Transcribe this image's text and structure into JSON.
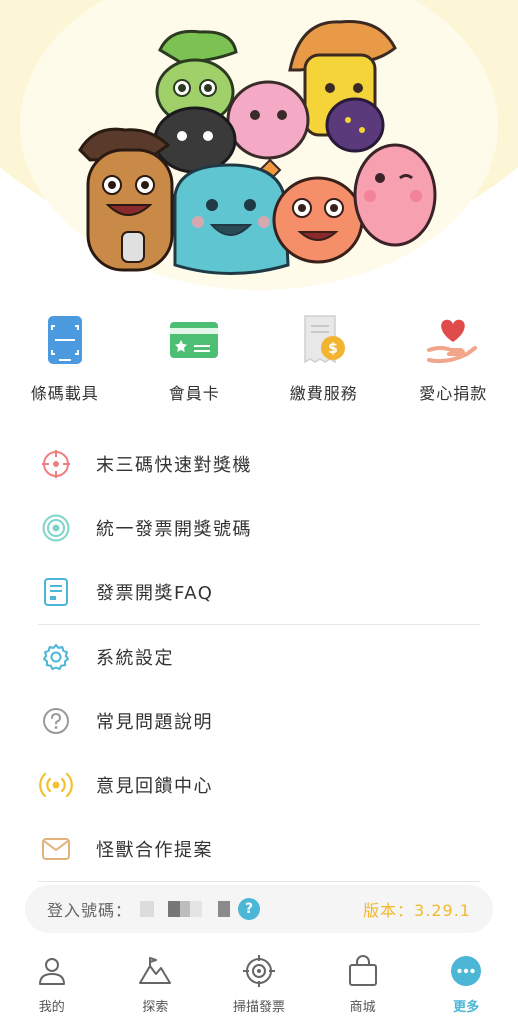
{
  "hero": {
    "icon": "monster-group-illustration"
  },
  "quick_actions": [
    {
      "label": "條碼載具",
      "icon": "barcode-carrier-icon"
    },
    {
      "label": "會員卡",
      "icon": "member-card-icon"
    },
    {
      "label": "繳費服務",
      "icon": "payment-service-icon"
    },
    {
      "label": "愛心捐款",
      "icon": "donation-heart-icon"
    }
  ],
  "menu": [
    {
      "label": "末三碼快速對獎機",
      "icon": "crosshair-icon"
    },
    {
      "label": "統一發票開獎號碼",
      "icon": "target-icon"
    },
    {
      "label": "發票開獎FAQ",
      "icon": "document-icon"
    },
    {
      "label": "系統設定",
      "icon": "gear-icon"
    },
    {
      "label": "常見問題說明",
      "icon": "question-icon"
    },
    {
      "label": "意見回饋中心",
      "icon": "broadcast-icon"
    },
    {
      "label": "怪獸合作提案",
      "icon": "mail-icon"
    }
  ],
  "login": {
    "label": "登入號碼：",
    "help": "?",
    "version": "版本：3.29.1"
  },
  "nav": [
    {
      "label": "我的",
      "icon": "person-icon",
      "active": false
    },
    {
      "label": "探索",
      "icon": "mountain-icon",
      "active": false
    },
    {
      "label": "掃描發票",
      "icon": "scan-target-icon",
      "active": false
    },
    {
      "label": "商城",
      "icon": "shopping-bag-icon",
      "active": false
    },
    {
      "label": "更多",
      "icon": "more-dots-icon",
      "active": true
    }
  ],
  "colors": {
    "accent": "#4bb6d6",
    "version": "#f1b830",
    "hero_bg": "#fdf6d6"
  }
}
